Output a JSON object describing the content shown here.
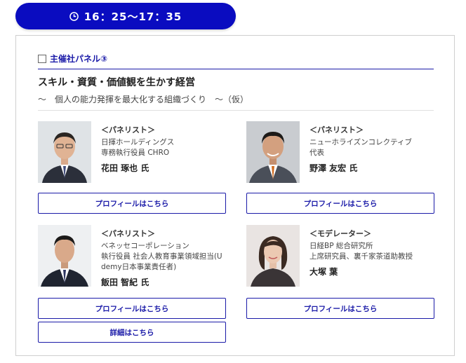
{
  "time": {
    "label": "16：25〜17：35"
  },
  "panel": {
    "label": "主催社パネル③",
    "title": "スキル・資質・価値観を生かす経営",
    "subtitle": "〜　個人の能力発揮を最大化する組織づくり　〜（仮）"
  },
  "people": [
    {
      "role": "＜パネリスト＞",
      "affiliation": [
        "日揮ホールディングス",
        "専務執行役員 CHRO"
      ],
      "name": "花田 琢也 氏",
      "profile_button": "プロフィールはこちら"
    },
    {
      "role": "＜パネリスト＞",
      "affiliation": [
        "ニューホライズンコレクティブ",
        "代表"
      ],
      "name": "野澤 友宏 氏",
      "profile_button": "プロフィールはこちら"
    },
    {
      "role": "＜パネリスト＞",
      "affiliation": [
        "ベネッセコーポレーション",
        "執行役員 社会人教育事業領域担当(U",
        "demy日本事業責任者)"
      ],
      "name": "飯田 智紀 氏",
      "profile_button": "プロフィールはこちら"
    },
    {
      "role": "＜モデレーター＞",
      "affiliation": [
        "日経BP 総合研究所",
        "上席研究員、裏千家茶道助教授"
      ],
      "name": "大塚 葉",
      "profile_button": "プロフィールはこちら"
    }
  ],
  "details_button": "詳細はこちら",
  "colors": {
    "accent": "#0a0cc0",
    "link": "#1a1aa8"
  },
  "icons": {
    "clock": "clock-icon",
    "checkbox": "checkbox-icon"
  }
}
